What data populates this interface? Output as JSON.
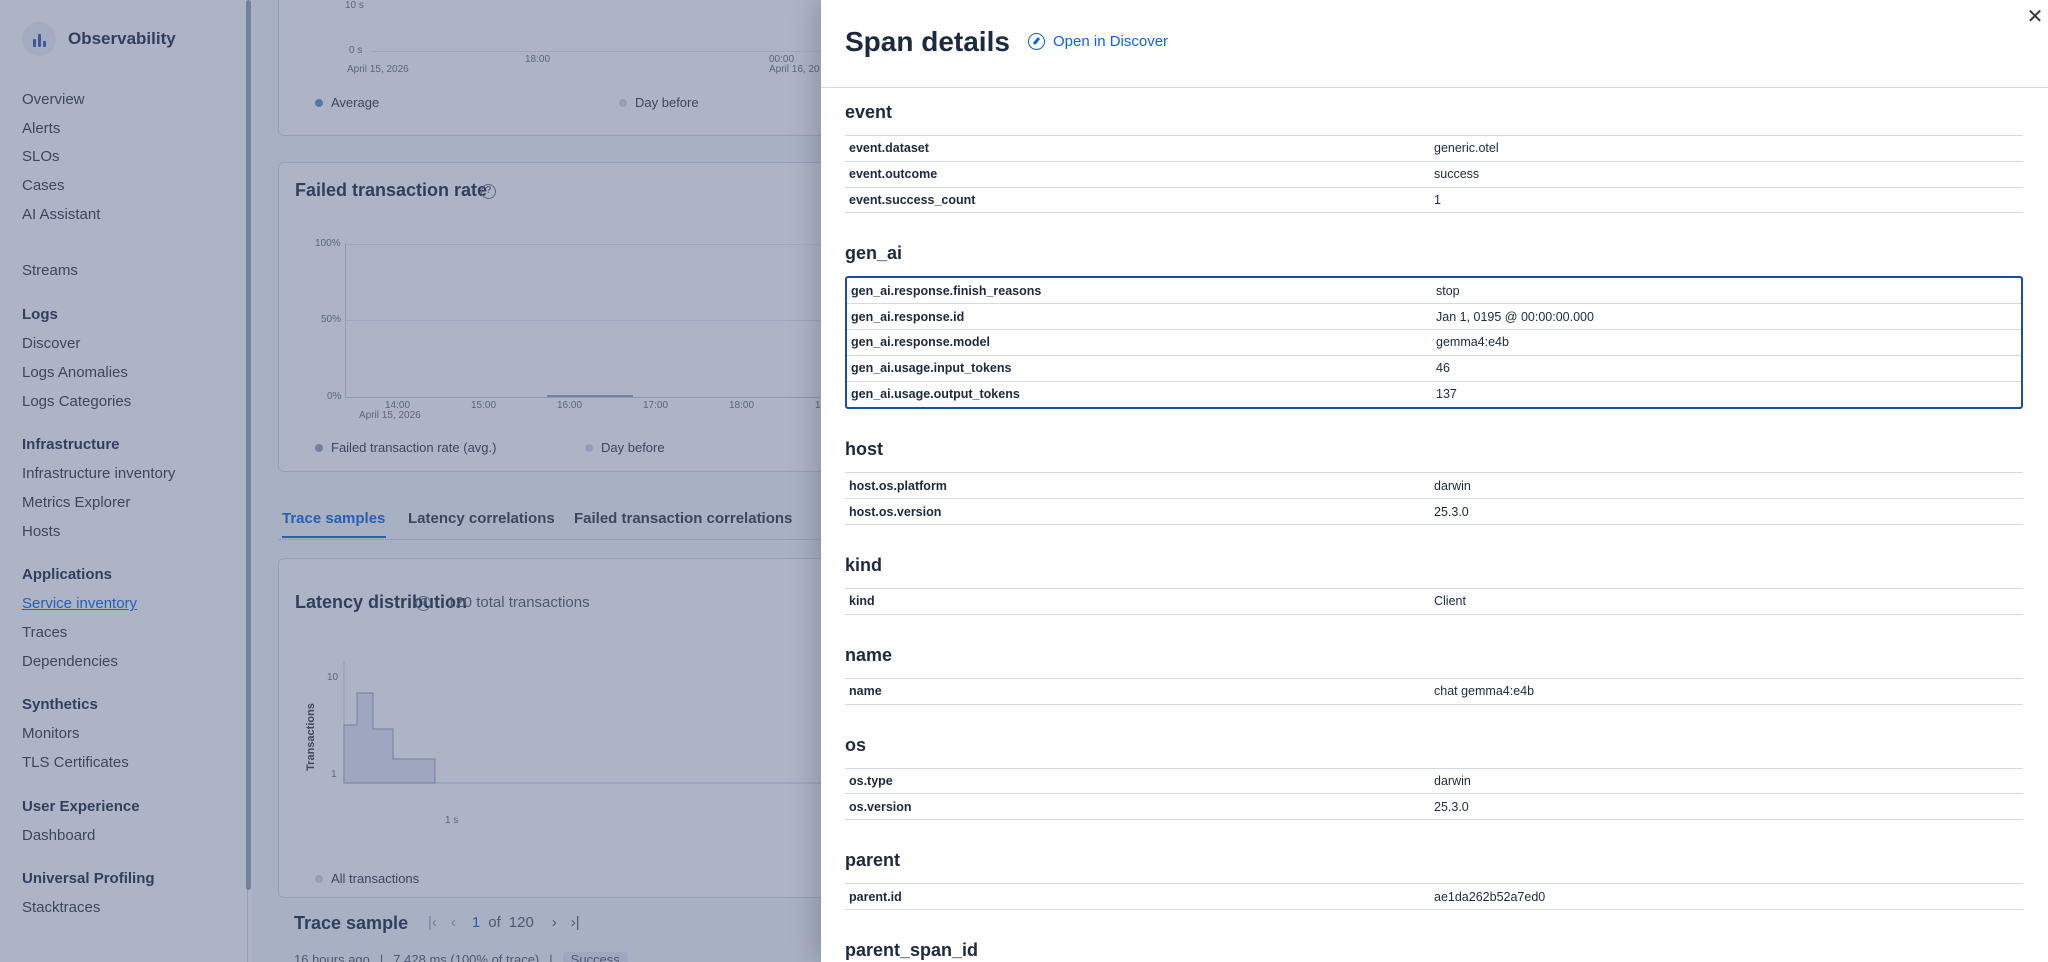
{
  "sidebar": {
    "brand": "Observability",
    "top_items": [
      "Overview",
      "Alerts",
      "SLOs",
      "Cases",
      "AI Assistant"
    ],
    "streams": "Streams",
    "groups": [
      {
        "title": "Logs",
        "items": [
          "Discover",
          "Logs Anomalies",
          "Logs Categories"
        ]
      },
      {
        "title": "Infrastructure",
        "items": [
          "Infrastructure inventory",
          "Metrics Explorer",
          "Hosts"
        ]
      },
      {
        "title": "Applications",
        "items": [
          "Service inventory",
          "Traces",
          "Dependencies"
        ]
      },
      {
        "title": "Synthetics",
        "items": [
          "Monitors",
          "TLS Certificates"
        ]
      },
      {
        "title": "User Experience",
        "items": [
          "Dashboard"
        ]
      },
      {
        "title": "Universal Profiling",
        "items": [
          "Stacktraces"
        ]
      }
    ],
    "active_item": "Service inventory"
  },
  "main": {
    "latency_chart": {
      "y_ticks": [
        "10 s",
        "0 s"
      ],
      "x_ticks": [
        "April 15, 2026",
        "18:00",
        "00:00",
        "April 16, 20"
      ],
      "legend": [
        "Average",
        "Day before"
      ]
    },
    "failed_rate": {
      "title": "Failed transaction rate",
      "y_ticks": [
        "100%",
        "50%",
        "0%"
      ],
      "x_ticks": [
        "14:00",
        "15:00",
        "16:00",
        "17:00",
        "18:00",
        "1"
      ],
      "x_date": "April 15, 2026",
      "legend": [
        "Failed transaction rate (avg.)",
        "Day before"
      ]
    },
    "tabs": [
      "Trace samples",
      "Latency correlations",
      "Failed transaction correlations"
    ],
    "latency_distribution": {
      "title": "Latency distribution",
      "subtitle": "120 total transactions",
      "y_label": "Transactions",
      "y_ticks": [
        "10",
        "1"
      ],
      "x_tick": "1 s",
      "legend": "All transactions"
    },
    "trace_sample": {
      "title": "Trace sample",
      "page": "1",
      "of": "of",
      "total": "120",
      "meta": "16 hours ago",
      "duration": "7,428 ms (100% of trace)",
      "badge": "Success"
    }
  },
  "flyout": {
    "title": "Span details",
    "discover_link": "Open in Discover",
    "sections": [
      {
        "name": "event",
        "rows": [
          [
            "event.dataset",
            "generic.otel"
          ],
          [
            "event.outcome",
            "success"
          ],
          [
            "event.success_count",
            "1"
          ]
        ]
      },
      {
        "name": "gen_ai",
        "highlight": true,
        "rows": [
          [
            "gen_ai.response.finish_reasons",
            "stop"
          ],
          [
            "gen_ai.response.id",
            "Jan 1, 0195 @ 00:00:00.000"
          ],
          [
            "gen_ai.response.model",
            "gemma4:e4b"
          ],
          [
            "gen_ai.usage.input_tokens",
            "46"
          ],
          [
            "gen_ai.usage.output_tokens",
            "137"
          ]
        ]
      },
      {
        "name": "host",
        "rows": [
          [
            "host.os.platform",
            "darwin"
          ],
          [
            "host.os.version",
            "25.3.0"
          ]
        ]
      },
      {
        "name": "kind",
        "rows": [
          [
            "kind",
            "Client"
          ]
        ]
      },
      {
        "name": "name",
        "rows": [
          [
            "name",
            "chat gemma4:e4b"
          ]
        ]
      },
      {
        "name": "os",
        "rows": [
          [
            "os.type",
            "darwin"
          ],
          [
            "os.version",
            "25.3.0"
          ]
        ]
      },
      {
        "name": "parent",
        "rows": [
          [
            "parent.id",
            "ae1da262b52a7ed0"
          ]
        ]
      },
      {
        "name": "parent_span_id",
        "rows": []
      }
    ]
  },
  "colors": {
    "accent": "#0b64dd",
    "highlight_border": "#1a4fa0",
    "overlay": "#4a5880"
  }
}
